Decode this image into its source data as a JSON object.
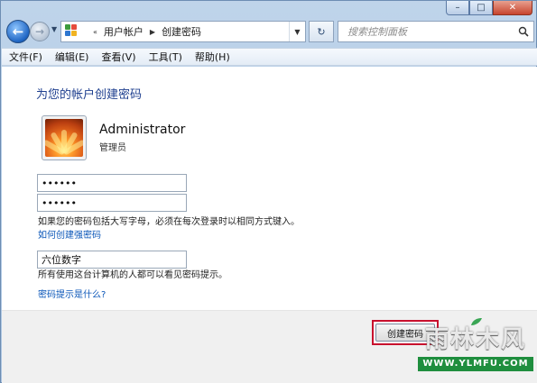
{
  "caption": {
    "minimize": "–",
    "maximize": "□",
    "close": "✕"
  },
  "nav": {
    "back_icon": "back-arrow-icon",
    "forward_icon": "forward-arrow-icon",
    "breadcrumb": [
      "用户帐户",
      "创建密码"
    ],
    "search_placeholder": "搜索控制面板"
  },
  "menu": [
    "文件(F)",
    "编辑(E)",
    "查看(V)",
    "工具(T)",
    "帮助(H)"
  ],
  "page": {
    "title": "为您的帐户创建密码",
    "user_name": "Administrator",
    "user_role": "管理员",
    "password_value": "••••••",
    "confirm_value": "••••••",
    "case_note": "如果您的密码包括大写字母，必须在每次登录时以相同方式键入。",
    "strong_link": "如何创建强密码",
    "hint_value": "六位数字",
    "hint_note": "所有使用这台计算机的人都可以看见密码提示。",
    "hint_link": "密码提示是什么?",
    "create_button": "创建密码"
  },
  "watermark": {
    "logo": "雨林木风",
    "url": "WWW.YLMFU.COM"
  },
  "colors": {
    "title": "#1e3f8f",
    "link": "#0a56b8",
    "highlight": "#c8102e"
  }
}
